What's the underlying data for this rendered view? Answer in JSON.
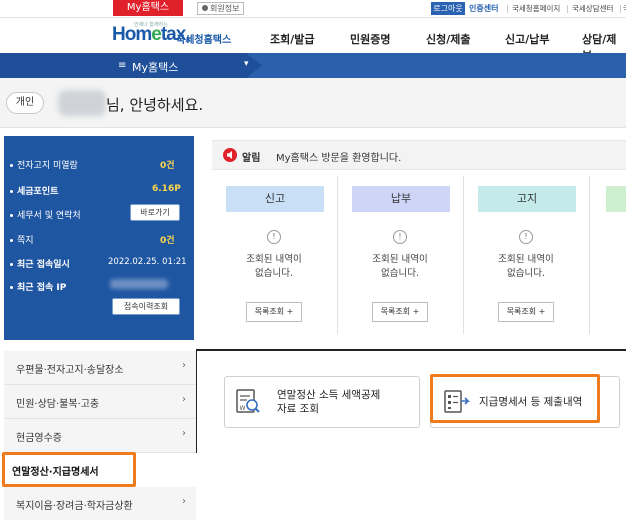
{
  "topbar": {
    "myhometax_tab": "My홈택스",
    "member_info": "회원정보",
    "logout": "로그아웃",
    "cert_center": "인증센터",
    "links": [
      "국세청홈페이지",
      "국세상담센터",
      "국세법령정보"
    ]
  },
  "logo": {
    "sub": "언제나 함께하는",
    "main_pre": "Hom",
    "main_e": "e",
    "main_post": "tax,",
    "kr": "국세청홈택스"
  },
  "gnb": [
    "조회/발급",
    "민원증명",
    "신청/제출",
    "신고/납부",
    "상담/제보"
  ],
  "menu_bar": {
    "title": "My홈택스",
    "caret": "▾",
    "menu_icon": "≡"
  },
  "greeting": {
    "type_badge": "개인",
    "name_suffix": "님, 안녕하세요."
  },
  "info": {
    "rows": [
      {
        "label": "전자고지 미열람",
        "value": "0건"
      },
      {
        "label": "세금포인트",
        "value": "6.16P"
      },
      {
        "label": "세무서 및 연락처",
        "button": "바로가기"
      },
      {
        "label": "쪽지",
        "value": "0건"
      },
      {
        "label": "최근 접속일시",
        "value": "2022.02.25. 01:21"
      },
      {
        "label": "최근 접속 IP",
        "value": ""
      }
    ],
    "history_button": "접속이력조회"
  },
  "alarm": {
    "label": "알림",
    "text": "My홈택스 방문을 환영합니다."
  },
  "cards": [
    {
      "title": "신고",
      "empty_line1": "조회된 내역이",
      "empty_line2": "없습니다.",
      "button": "목록조회 +",
      "color": "#c9dff5"
    },
    {
      "title": "납부",
      "empty_line1": "조회된 내역이",
      "empty_line2": "없습니다.",
      "button": "목록조회 +",
      "color": "#cfd5f6"
    },
    {
      "title": "고지",
      "empty_line1": "조회된 내역이",
      "empty_line2": "없습니다.",
      "button": "목록조회 +",
      "color": "#c4ebea"
    }
  ],
  "left_menu": [
    {
      "label": "우편물·전자고지·송달장소",
      "arrow": "›"
    },
    {
      "label": "민원·상담·불복·고충",
      "arrow": "›"
    },
    {
      "label": "현금영수증",
      "arrow": "›"
    },
    {
      "label": "연말정산·지급명세서",
      "arrow": ""
    },
    {
      "label": "복지이음·장려금·학자금상환",
      "arrow": "›"
    }
  ],
  "sub_items": [
    {
      "line1": "연말정산 소득 세액공제",
      "line2": "자료 조회"
    },
    {
      "line1": "지급명세서 등 제출내역",
      "line2": ""
    }
  ],
  "colors": {
    "brand_blue": "#2b60ad",
    "info_box": "#1f56a2",
    "accent_red": "#e0212b",
    "highlight_orange": "#f07b1d",
    "point_yellow": "#ffd84a"
  }
}
